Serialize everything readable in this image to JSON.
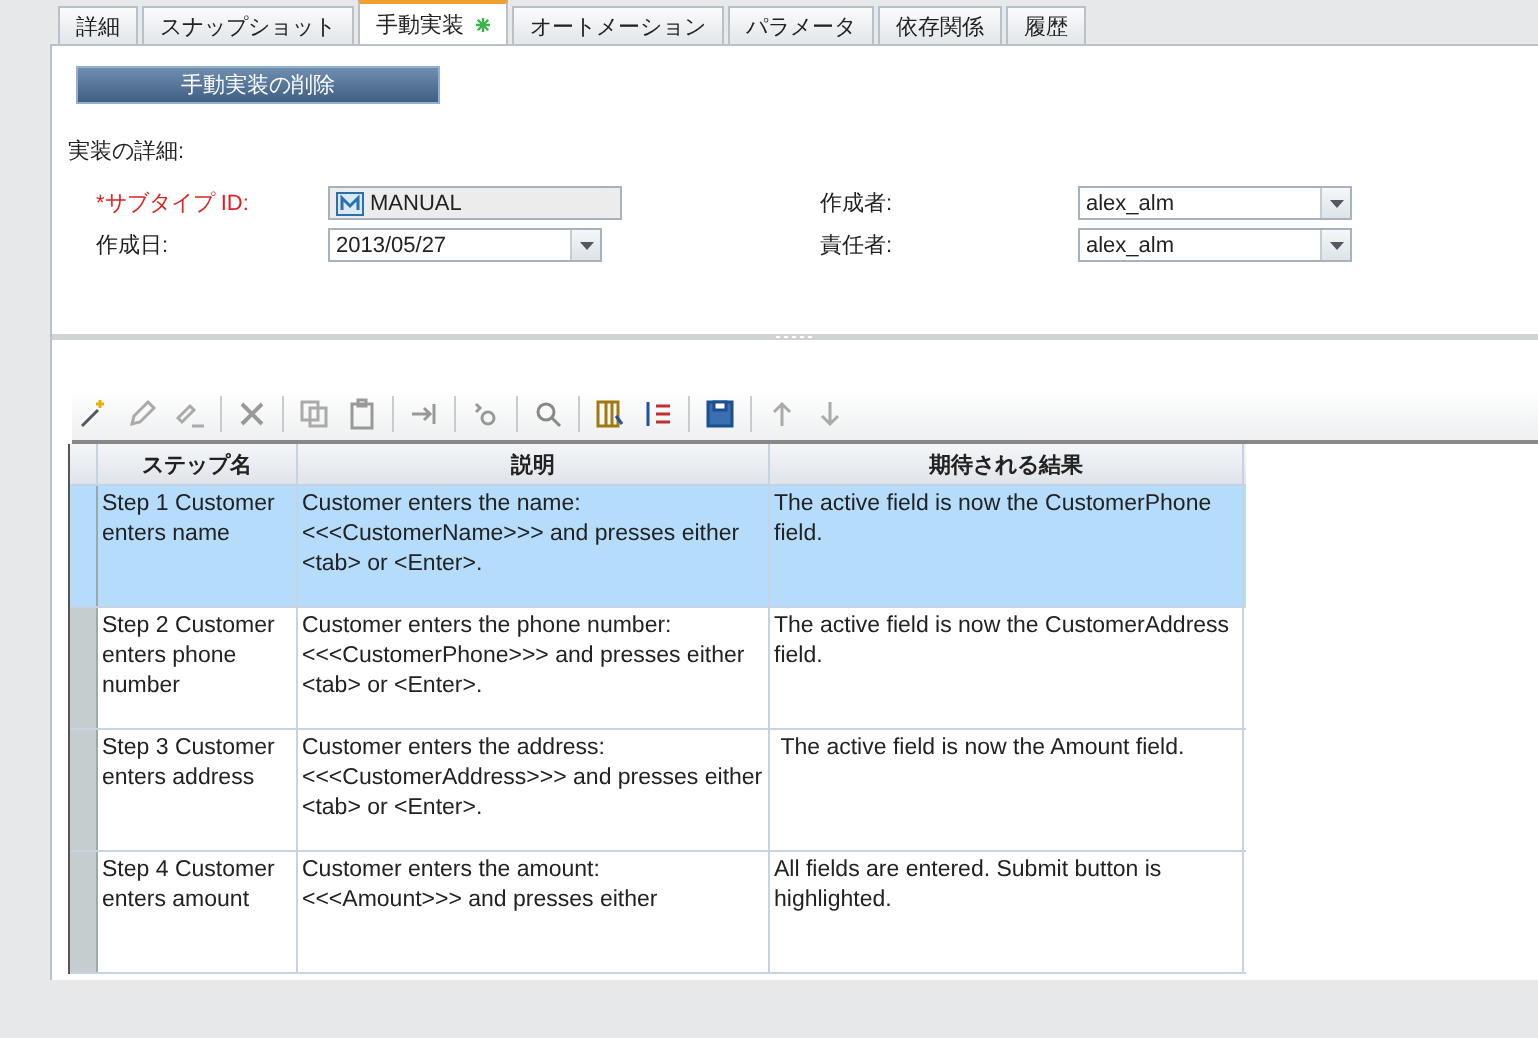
{
  "tabs": [
    {
      "label": "詳細",
      "selected": false,
      "modified": false
    },
    {
      "label": "スナップショット",
      "selected": false,
      "modified": false
    },
    {
      "label": "手動実装",
      "selected": true,
      "modified": true
    },
    {
      "label": "オートメーション",
      "selected": false,
      "modified": false
    },
    {
      "label": "パラメータ",
      "selected": false,
      "modified": false
    },
    {
      "label": "依存関係",
      "selected": false,
      "modified": false
    },
    {
      "label": "履歴",
      "selected": false,
      "modified": false
    }
  ],
  "delete_button": "手動実装の削除",
  "section_title": "実装の詳細:",
  "fields_left": [
    {
      "label": "*サブタイプ ID:",
      "required": true,
      "kind": "readonly",
      "value": "MANUAL"
    },
    {
      "label": "作成日:",
      "required": false,
      "kind": "dropdown",
      "value": "2013/05/27"
    }
  ],
  "fields_right": [
    {
      "label": "作成者:",
      "required": false,
      "kind": "dropdown",
      "value": "alex_alm"
    },
    {
      "label": "責任者:",
      "required": false,
      "kind": "dropdown",
      "value": "alex_alm"
    }
  ],
  "table": {
    "columns": [
      "ステップ名",
      "説明",
      "期待される結果"
    ],
    "rows": [
      {
        "selected": true,
        "name": "Step 1 Customer enters name",
        "description": "Customer enters the name: <<<CustomerName>>> and presses either <tab> or <Enter>.",
        "expected": "The active field is now the CustomerPhone field."
      },
      {
        "selected": false,
        "name": "Step 2 Customer enters phone number",
        "description": "Customer enters the phone number: <<<CustomerPhone>>> and presses either <tab> or <Enter>.",
        "expected": "The active field is now the CustomerAddress field."
      },
      {
        "selected": false,
        "name": "Step 3 Customer enters address",
        "description": "Customer enters the address: <<<CustomerAddress>>> and presses either <tab> or <Enter>.",
        "expected": " The active field is now the Amount field."
      },
      {
        "selected": false,
        "name": "Step 4 Customer enters amount",
        "description": "Customer enters the amount: <<<Amount>>> and presses either",
        "expected": "All fields are entered. Submit button is highlighted."
      }
    ]
  }
}
